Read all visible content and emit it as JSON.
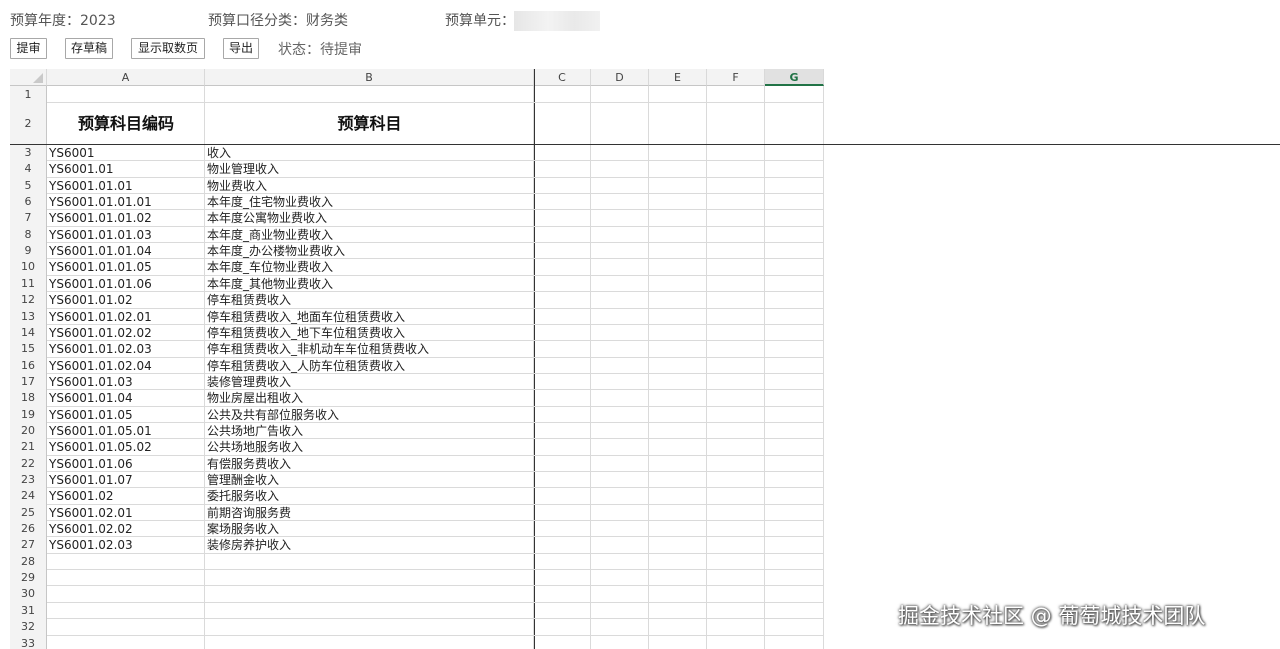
{
  "info": {
    "year_label": "预算年度：2023",
    "category_label": "预算口径分类：财务类",
    "unit_label": "预算单元："
  },
  "toolbar": {
    "submit": "提审",
    "save_draft": "存草稿",
    "show_fetch_page": "显示取数页",
    "export": "导出",
    "status": "状态：待提审"
  },
  "columns": [
    "A",
    "B",
    "C",
    "D",
    "E",
    "F",
    "G"
  ],
  "selected_column": "G",
  "header_row": {
    "code": "预算科目编码",
    "name": "预算科目"
  },
  "rows": [
    {
      "code": "YS6001",
      "name": "收入"
    },
    {
      "code": "YS6001.01",
      "name": "物业管理收入"
    },
    {
      "code": "YS6001.01.01",
      "name": "物业费收入"
    },
    {
      "code": "YS6001.01.01.01",
      "name": "本年度_住宅物业费收入"
    },
    {
      "code": "YS6001.01.01.02",
      "name": "本年度公寓物业费收入"
    },
    {
      "code": "YS6001.01.01.03",
      "name": "本年度_商业物业费收入"
    },
    {
      "code": "YS6001.01.01.04",
      "name": "本年度_办公楼物业费收入"
    },
    {
      "code": "YS6001.01.01.05",
      "name": "本年度_车位物业费收入"
    },
    {
      "code": "YS6001.01.01.06",
      "name": "本年度_其他物业费收入"
    },
    {
      "code": "YS6001.01.02",
      "name": "停车租赁费收入"
    },
    {
      "code": "YS6001.01.02.01",
      "name": "停车租赁费收入_地面车位租赁费收入"
    },
    {
      "code": "YS6001.01.02.02",
      "name": "停车租赁费收入_地下车位租赁费收入"
    },
    {
      "code": "YS6001.01.02.03",
      "name": "停车租赁费收入_非机动车车位租赁费收入"
    },
    {
      "code": "YS6001.01.02.04",
      "name": "停车租赁费收入_人防车位租赁费收入"
    },
    {
      "code": "YS6001.01.03",
      "name": "装修管理费收入"
    },
    {
      "code": "YS6001.01.04",
      "name": "物业房屋出租收入"
    },
    {
      "code": "YS6001.01.05",
      "name": "公共及共有部位服务收入"
    },
    {
      "code": "YS6001.01.05.01",
      "name": "公共场地广告收入"
    },
    {
      "code": "YS6001.01.05.02",
      "name": "公共场地服务收入"
    },
    {
      "code": "YS6001.01.06",
      "name": "有偿服务费收入"
    },
    {
      "code": "YS6001.01.07",
      "name": "管理酬金收入"
    },
    {
      "code": "YS6001.02",
      "name": "委托服务收入"
    },
    {
      "code": "YS6001.02.01",
      "name": "前期咨询服务费"
    },
    {
      "code": "YS6001.02.02",
      "name": "案场服务收入"
    },
    {
      "code": "YS6001.02.03",
      "name": "装修房养护收入"
    }
  ],
  "empty_rows": [
    28,
    29,
    30,
    31,
    32,
    33
  ],
  "watermark": "掘金技术社区 @ 葡萄城技术团队"
}
